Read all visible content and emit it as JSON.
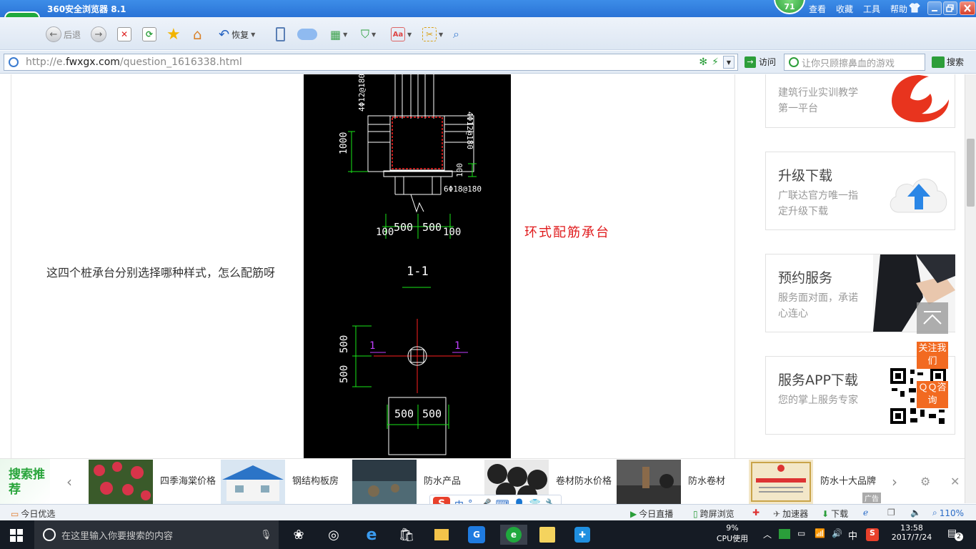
{
  "browser": {
    "title": "360安全浏览器 8.1",
    "badge": "71",
    "menu": [
      "查看",
      "收藏",
      "工具",
      "帮助"
    ]
  },
  "toolbar": {
    "back": "后退",
    "restore": "恢复"
  },
  "address": {
    "url_prefix": "http://e.",
    "url_host": "fwxgx.com",
    "url_path": "/question_1616338.html",
    "visit": "访问",
    "search_placeholder": "让你只顾擦鼻血的游戏",
    "search_button": "搜索"
  },
  "content": {
    "question": "这四个桩承台分别选择哪种样式，怎么配筋呀",
    "caption": "环式配筋承台",
    "drawing": {
      "label_a": "4Φ12@180",
      "label_b": "4Φ12@180",
      "dim_1000": "1000",
      "dim_100": "100",
      "label_c": "6Φ18@180",
      "dims_bottom": [
        "100",
        "500",
        "500",
        "100"
      ],
      "section": "1-1",
      "plan_left_dims": [
        "500",
        "500"
      ],
      "plan_bottom_dims": [
        "500",
        "500"
      ],
      "cut_mark": "1"
    }
  },
  "sidebar": {
    "cards": [
      {
        "title": "",
        "sub": "建筑行业实训教学第一平台"
      },
      {
        "title": "升级下载",
        "sub": "广联达官方唯一指定升级下载"
      },
      {
        "title": "预约服务",
        "sub": "服务面对面，承诺心连心"
      },
      {
        "title": "服务APP下载",
        "sub": "您的掌上服务专家"
      }
    ],
    "follow": "关注我们",
    "qq": "ＱＱ咨询"
  },
  "recommend": {
    "title": "搜索推荐",
    "items": [
      "四季海棠价格",
      "钢结构板房",
      "防水产品",
      "卷材防水价格",
      "防水卷材",
      "防水十大品牌"
    ],
    "ad": "广告"
  },
  "ime": {
    "lang": "中"
  },
  "status": {
    "today": "今日优选",
    "live": "今日直播",
    "cross": "跨屏浏览",
    "accel": "加速器",
    "download": "下载",
    "zoom": "110%"
  },
  "taskbar": {
    "search": "在这里输入你要搜索的内容",
    "cpu": "9%",
    "cpu_label": "CPU使用",
    "ime": "中",
    "time": "13:58",
    "date": "2017/7/24",
    "notify": "2"
  }
}
